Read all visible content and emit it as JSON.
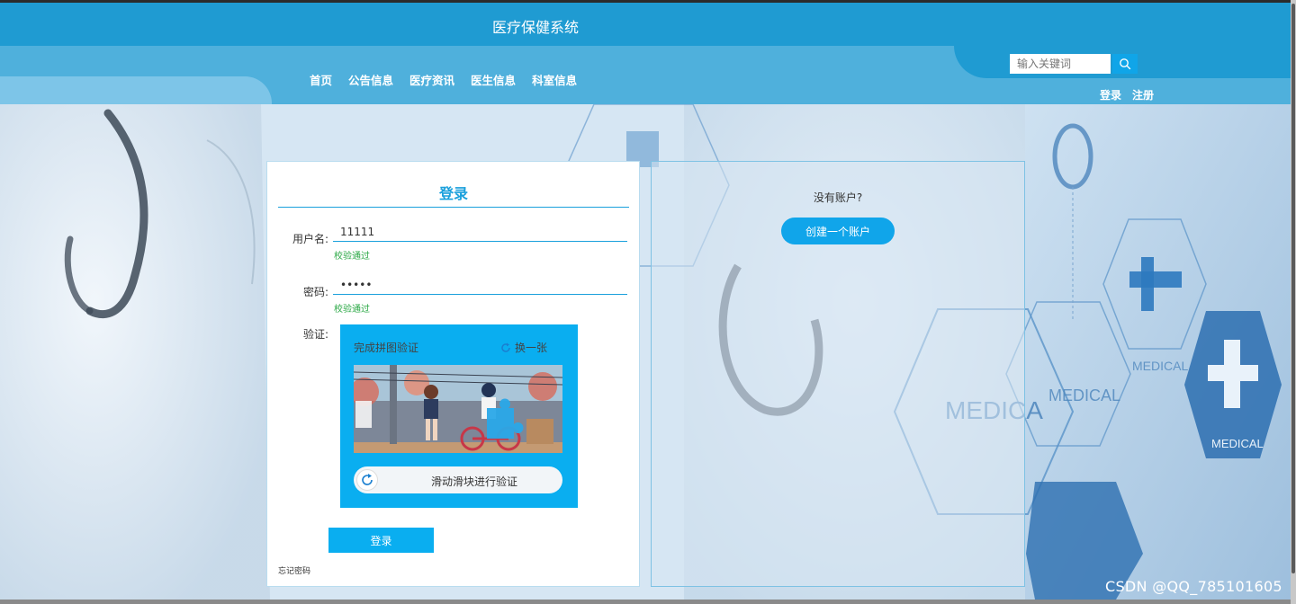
{
  "header": {
    "title": "医疗保健系统",
    "nav": [
      {
        "label": "首页"
      },
      {
        "label": "公告信息"
      },
      {
        "label": "医疗资讯"
      },
      {
        "label": "医生信息"
      },
      {
        "label": "科室信息"
      }
    ],
    "search_placeholder": "输入关键词",
    "login_link": "登录",
    "register_link": "注册"
  },
  "background": {
    "labels": [
      "MEDICA",
      "MEDICAL",
      "MEDICAL",
      "MEDICAL"
    ]
  },
  "login": {
    "title": "登录",
    "username_label": "用户名:",
    "username_value": "11111",
    "username_tip": "校验通过",
    "password_label": "密码:",
    "password_value": "•••••",
    "password_tip": "校验通过",
    "captcha_label": "验证:",
    "captcha_title": "完成拼图验证",
    "captcha_refresh": "换一张",
    "slider_text": "滑动滑块进行验证",
    "button": "登录",
    "forgot": "忘记密码"
  },
  "register": {
    "no_account": "没有账户?",
    "create_button": "创建一个账户"
  },
  "watermark": "CSDN @QQ_785101605",
  "colors": {
    "header": "#1f9bd2",
    "nav_band": "#4fb0dc",
    "accent": "#0aaef0",
    "valid": "#2aa845"
  }
}
